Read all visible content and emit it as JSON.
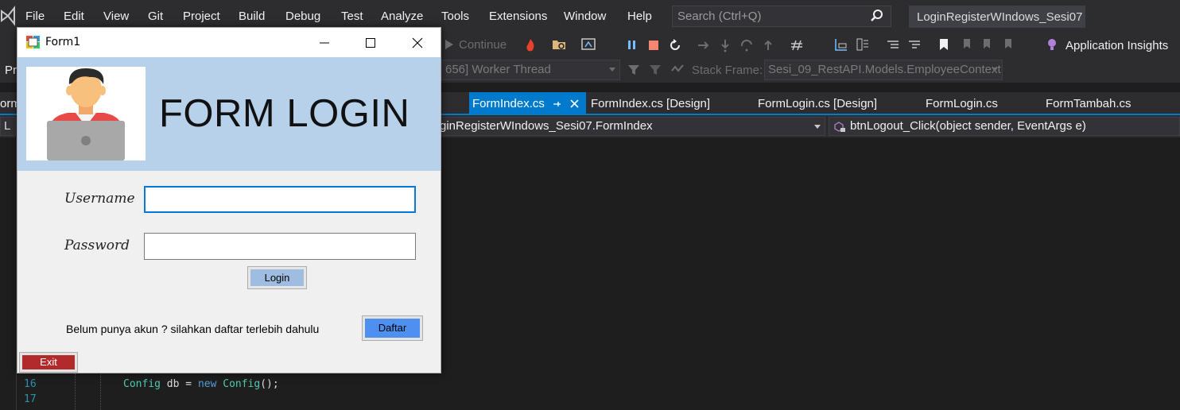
{
  "vs": {
    "menu": [
      "File",
      "Edit",
      "View",
      "Git",
      "Project",
      "Build",
      "Debug",
      "Test",
      "Analyze",
      "Tools",
      "Extensions",
      "Window",
      "Help"
    ],
    "search_placeholder": "Search (Ctrl+Q)",
    "solution_name": "LoginRegisterWIndows_Sesi07",
    "continue_label": "Continue",
    "app_insights": "Application Insights",
    "thread_combo": "656] Worker Thread",
    "stack_frame_label": "Stack Frame:",
    "stack_frame_value": "Sesi_09_RestAPI.Models.EmployeeContext",
    "tabs": [
      "FormIndex.cs",
      "FormIndex.cs [Design]",
      "FormLogin.cs [Design]",
      "FormLogin.cs",
      "FormTambah.cs"
    ],
    "left_tab_fragment": "orm",
    "left_proj_fragment": "Pr",
    "nav_class": "ginRegisterWIndows_Sesi07.FormIndex",
    "nav_member": "btnLogout_Click(object sender, EventArgs e)",
    "nav_left_fragment": "L",
    "line_numbers": [
      "16",
      "17"
    ],
    "code": {
      "type": "Config",
      "var": "db",
      "op": " = ",
      "kw_new": "new",
      "ctor": "Config",
      "tail": "();"
    },
    "colors": {
      "accent": "#007acc",
      "bg": "#1e1e1e"
    }
  },
  "form": {
    "title": "Form1",
    "heading": "FORM LOGIN",
    "username_label": "Username",
    "password_label": "Password",
    "username_value": "",
    "password_value": "",
    "login_button": "Login",
    "register_prompt": "Belum punya akun ? silahkan daftar terlebih dahulu",
    "daftar_button": "Daftar",
    "exit_button": "Exit",
    "colors": {
      "header": "#b8d1eb",
      "login": "#9fbde0",
      "daftar": "#4d90f0",
      "exit": "#b22a2a"
    }
  }
}
